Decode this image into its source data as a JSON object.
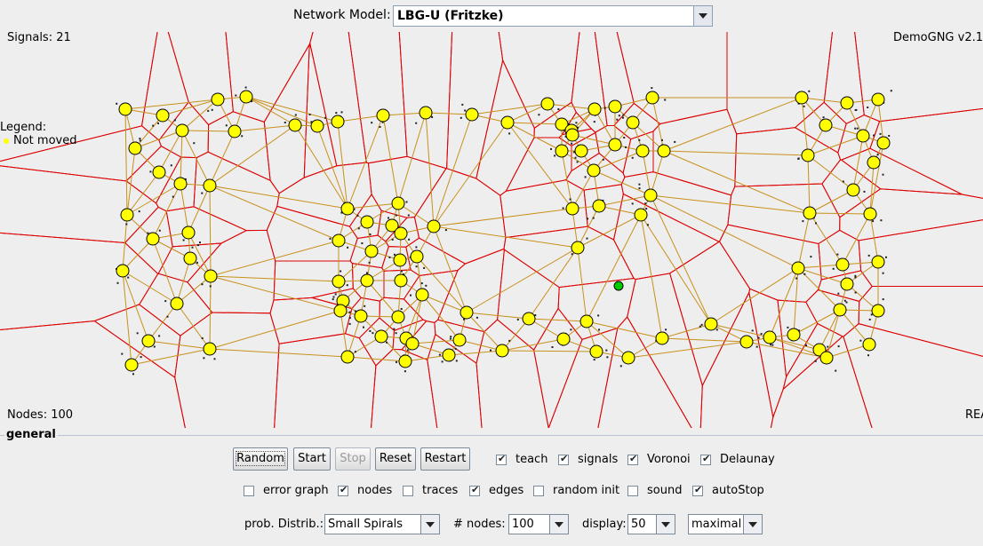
{
  "network_model": {
    "label": "Network Model:",
    "value": "LBG-U (Fritzke)"
  },
  "status": {
    "signals": "Signals: 21",
    "version": "DemoGNG v2.1",
    "nodes": "Nodes: 100",
    "right_clip": "REA"
  },
  "legend": {
    "title": "Legend:",
    "item": "Not moved"
  },
  "panel": {
    "title": "general"
  },
  "buttons": {
    "random": "Random",
    "start": "Start",
    "stop": "Stop",
    "reset": "Reset",
    "restart": "Restart"
  },
  "checkboxes_row1": [
    {
      "label": "teach",
      "checked": true
    },
    {
      "label": "signals",
      "checked": true
    },
    {
      "label": "Voronoi",
      "checked": true
    },
    {
      "label": "Delaunay",
      "checked": true
    }
  ],
  "checkboxes_row2": [
    {
      "label": "error graph",
      "checked": false
    },
    {
      "label": "nodes",
      "checked": true
    },
    {
      "label": "traces",
      "checked": false
    },
    {
      "label": "edges",
      "checked": true
    },
    {
      "label": "random init",
      "checked": false
    },
    {
      "label": "sound",
      "checked": false
    },
    {
      "label": "autoStop",
      "checked": true
    }
  ],
  "controls": {
    "distrib_label": "prob. Distrib.:",
    "distrib_value": "Small Spirals",
    "nodes_label": "# nodes:",
    "nodes_value": "100",
    "display_label": "display:",
    "display_value": "50",
    "speed_value": "maximal"
  },
  "colors": {
    "node": "#ffff00",
    "edge": "#c8901a",
    "voronoi": "#dd0000",
    "active_node": "#00cc00"
  }
}
